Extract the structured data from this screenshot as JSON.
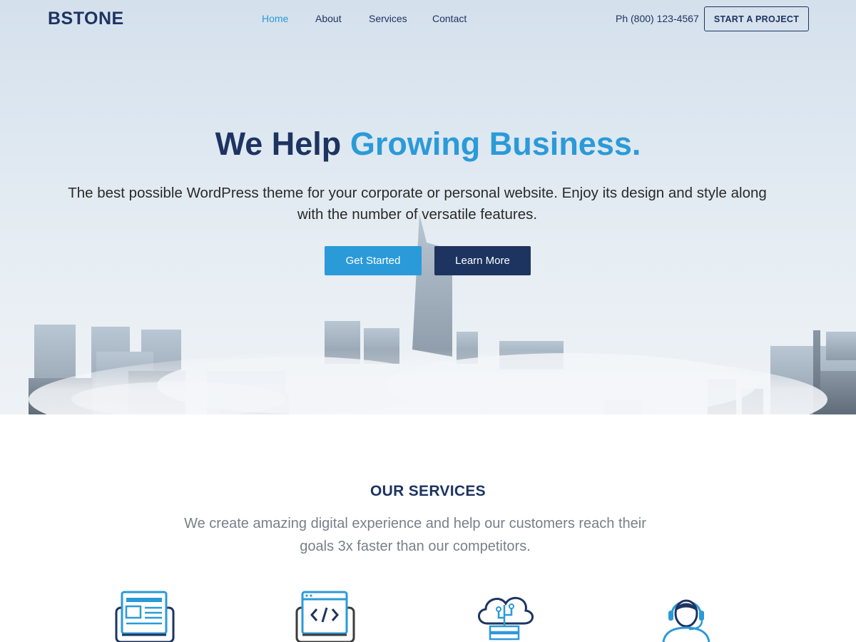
{
  "header": {
    "logo": "BSTONE",
    "nav": [
      {
        "label": "Home",
        "active": true
      },
      {
        "label": "About",
        "active": false
      },
      {
        "label": "Services",
        "active": false
      },
      {
        "label": "Contact",
        "active": false
      }
    ],
    "phone": "Ph (800) 123-4567",
    "cta_label": "START A PROJECT"
  },
  "hero": {
    "title_part1": "We Help ",
    "title_accent": "Growing Business.",
    "subtitle": "The best possible WordPress theme for your corporate or personal website. Enjoy its design and style along with the number of versatile features.",
    "primary_button": "Get Started",
    "secondary_button": "Learn More"
  },
  "services": {
    "title": "OUR SERVICES",
    "subtitle": "We create amazing digital experience and help our customers reach their goals 3x faster than our competitors.",
    "icons": [
      "web-design-icon",
      "web-development-icon",
      "cloud-network-icon",
      "customer-support-icon"
    ]
  },
  "colors": {
    "brand_dark": "#1d3461",
    "accent_blue": "#2b9ad8",
    "muted_text": "#7a7f88"
  }
}
